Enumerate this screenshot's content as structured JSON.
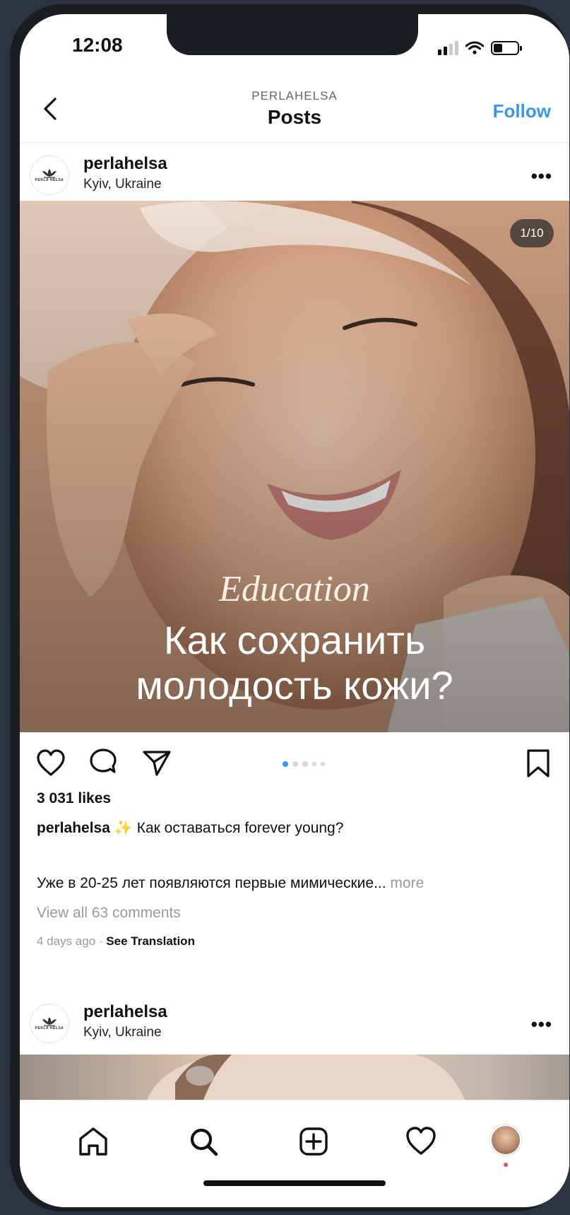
{
  "status_bar": {
    "time": "12:08"
  },
  "header": {
    "username_caps": "PERLAHELSA",
    "title": "Posts",
    "follow_label": "Follow"
  },
  "post": {
    "username": "perlahelsa",
    "location": "Kyiv, Ukraine",
    "avatar_logo_text": "PERLA HELSA",
    "more_label": "•••",
    "image": {
      "counter": "1/10",
      "label_script": "Education",
      "title_line1": "Как сохранить",
      "title_line2": "молодость кожи?"
    },
    "carousel": {
      "total_dots": 5,
      "active_index": 0
    },
    "likes": "3 031 likes",
    "caption_username": "perlahelsa",
    "caption_emoji": "✨",
    "caption_text": "Как оставаться forever young?",
    "caption_body": "Уже в 20-25 лет появляются первые мимические...",
    "more_link": "more",
    "view_comments": "View all 63 comments",
    "time_ago": "4 days ago",
    "separator": " · ",
    "see_translation": "See Translation"
  },
  "post2": {
    "username": "perlahelsa",
    "location": "Kyiv, Ukraine",
    "avatar_logo_text": "PERLA HELSA",
    "more_label": "•••"
  },
  "icons": {
    "back": "chevron-left-icon",
    "like": "heart-icon",
    "comment": "comment-bubble-icon",
    "share": "paper-plane-icon",
    "save": "bookmark-icon",
    "home": "home-icon",
    "search": "search-icon",
    "create": "plus-square-icon",
    "activity": "heart-icon",
    "profile": "avatar"
  },
  "colors": {
    "accent": "#3897f0",
    "text": "#111111",
    "muted": "#9a9a9a",
    "notification_dot": "#ed4956"
  }
}
